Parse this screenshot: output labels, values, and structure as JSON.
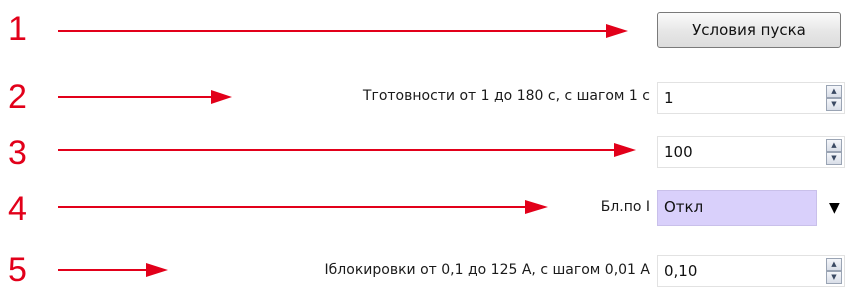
{
  "rows": [
    {
      "number": "1"
    },
    {
      "number": "2",
      "label": "Тготовности от 1 до 180 с, с шагом 1 с",
      "value": "1"
    },
    {
      "number": "3",
      "value": "100"
    },
    {
      "number": "4",
      "label": "Бл.по I",
      "value": "Откл"
    },
    {
      "number": "5",
      "label": "Iблокировки от 0,1 до 125 А, с шагом 0,01 А",
      "value": "0,10"
    }
  ],
  "start_conditions_button": "Условия пуска",
  "icons": {
    "up": "▲",
    "down": "▼",
    "dropdown": "▼"
  },
  "colors": {
    "annotation": "#e2001a",
    "combo_background": "#d9d0fb"
  }
}
